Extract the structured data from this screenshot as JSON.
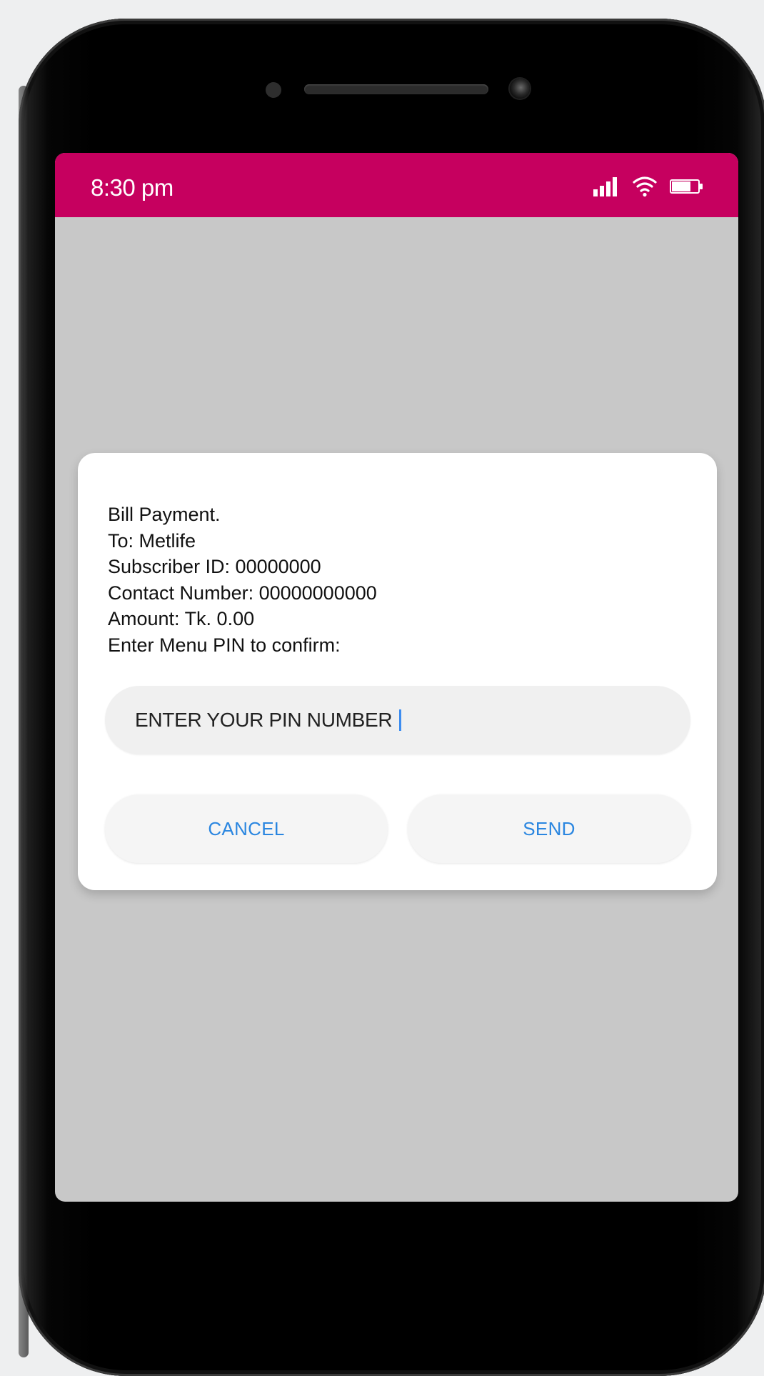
{
  "status_bar": {
    "time": "8:30 pm",
    "icons": [
      "signal-icon",
      "wifi-icon",
      "battery-icon"
    ],
    "color": "#c6005f"
  },
  "dialog": {
    "message_lines": [
      "Bill Payment.",
      "To: Metlife",
      "Subscriber ID: 00000000",
      "Contact Number: 00000000000",
      "Amount: Tk. 0.00",
      "Enter Menu PIN to confirm:"
    ],
    "pin_input": {
      "placeholder": "ENTER YOUR PIN NUMBER"
    },
    "buttons": {
      "cancel": "CANCEL",
      "send": "SEND"
    },
    "button_text_color": "#2a86e0"
  }
}
